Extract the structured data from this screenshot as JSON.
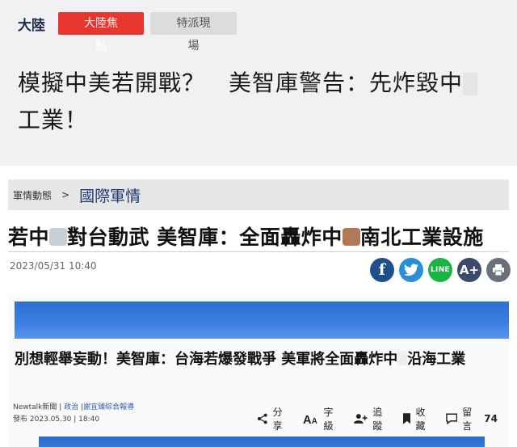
{
  "nav": {
    "home": "大陸",
    "tabs": [
      {
        "label": "大陸焦點",
        "active": true
      },
      {
        "label": "特派現場",
        "active": false
      }
    ]
  },
  "hero": {
    "title_line1": "模擬中美若開戰？　美智庫警告：先炸毀中",
    "title_line2": "工業！"
  },
  "breadcrumb": {
    "parent": "軍情動態",
    "separator": ">",
    "current": "國際軍情"
  },
  "article": {
    "headline_part1": "若中",
    "headline_part2": "對台動武 美智庫：全面轟炸中",
    "headline_part3": "南北工業設施",
    "date": "2023/05/31 10:40"
  },
  "share": {
    "facebook": "f",
    "line": "LINE",
    "font_size": "A+"
  },
  "card": {
    "title_part1": "別想輕舉妄動！美智庫：台海若爆發戰爭 美軍將全面轟炸中",
    "title_part2": "沿海工業",
    "source": "Newtalk新聞",
    "category": "政治",
    "author": "謝宜臻綜合報導",
    "published": "發布 2023.05.30 | 18:40",
    "actions": {
      "share": "分享",
      "font": "字級",
      "follow": "追蹤",
      "bookmark": "收藏",
      "comment": "留言",
      "comment_count": "74"
    }
  },
  "colors": {
    "accent_red": "#e8352e",
    "navy": "#1b2a4a",
    "facebook": "#1f4f8a",
    "twitter": "#2a8fd6",
    "line": "#18b545"
  }
}
